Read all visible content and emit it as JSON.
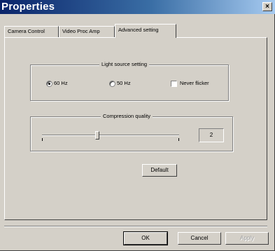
{
  "window": {
    "title": "Properties",
    "close_glyph": "×"
  },
  "tabs": [
    {
      "label": "Camera Control",
      "active": false
    },
    {
      "label": "Video Proc Amp",
      "active": false
    },
    {
      "label": "Advanced setting",
      "active": true
    }
  ],
  "light_source": {
    "legend": "Light source setting",
    "options": [
      {
        "label": "60 Hz",
        "checked": true
      },
      {
        "label": "50 Hz",
        "checked": false
      }
    ],
    "never_flicker": {
      "label": "Never flicker",
      "checked": false
    }
  },
  "compression": {
    "legend": "Compression quality",
    "value": "2",
    "slider_fraction": 0.4
  },
  "buttons": {
    "default": "Default",
    "ok": "OK",
    "cancel": "Cancel",
    "apply": "Apply"
  },
  "icons": {
    "close": "close-icon"
  },
  "colors": {
    "titlebar_start": "#0a246a",
    "titlebar_end": "#a6caf0",
    "face": "#d4d0c8"
  }
}
